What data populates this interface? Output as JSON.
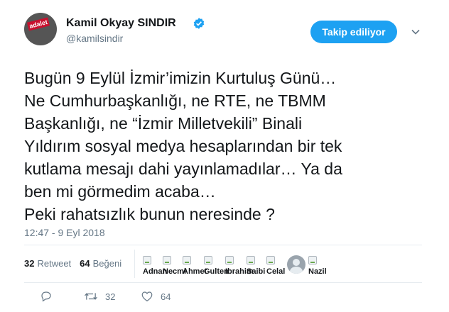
{
  "author": {
    "display_name": "Kamil Okyay SINDIR",
    "handle": "@kamilsindir",
    "avatar_text": "adalet"
  },
  "follow_button": {
    "label": "Takip ediliyor"
  },
  "tweet": {
    "text": "Bugün 9 Eylül İzmir’imizin Kurtuluş Günü…\nNe Cumhurbaşkanlığı, ne RTE, ne TBMM\nBaşkanlığı, ne “İzmir Milletvekili” Binali\nYıldırım sosyal medya hesaplarından bir tek\nkutlama mesajı dahi yayınlamadılar… Ya da\nben mi görmedim acaba…\nPeki rahatsızlık bunun neresinde ?",
    "timestamp": "12:47 - 9 Eyl 2018"
  },
  "stats": {
    "retweets_count": "32",
    "retweets_label": "Retweet",
    "likes_count": "64",
    "likes_label": "Beğeni"
  },
  "likers": [
    "Adnan",
    "Necmi",
    "Ahmet",
    "Gulten",
    "Ibrahim",
    "Saibi",
    "Celal",
    "Nazil"
  ],
  "actions": {
    "reply_count": "",
    "retweet_count": "32",
    "like_count": "64"
  },
  "colors": {
    "accent": "#1da1f2",
    "muted": "#657786",
    "text": "#14171a"
  },
  "icons": [
    "verified-badge-icon",
    "chevron-down-icon",
    "reply-icon",
    "retweet-icon",
    "heart-icon"
  ]
}
